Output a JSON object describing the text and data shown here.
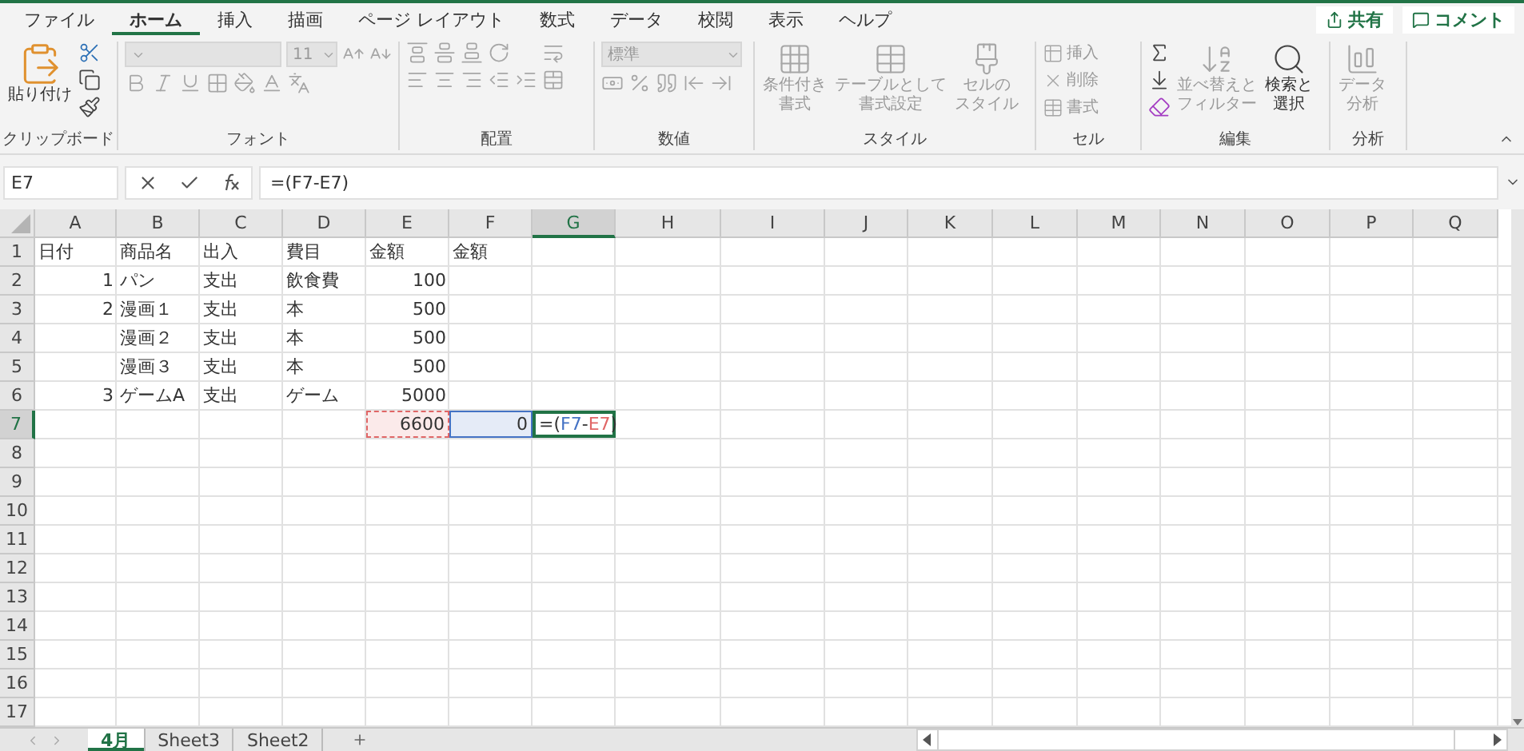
{
  "menu_tabs": [
    {
      "label": "ファイル",
      "selected": false
    },
    {
      "label": "ホーム",
      "selected": true
    },
    {
      "label": "挿入",
      "selected": false
    },
    {
      "label": "描画",
      "selected": false
    },
    {
      "label": "ページ レイアウト",
      "selected": false
    },
    {
      "label": "数式",
      "selected": false
    },
    {
      "label": "データ",
      "selected": false
    },
    {
      "label": "校閲",
      "selected": false
    },
    {
      "label": "表示",
      "selected": false
    },
    {
      "label": "ヘルプ",
      "selected": false
    }
  ],
  "share_button": "共有",
  "comment_button": "コメント",
  "ribbon_groups": [
    {
      "kind": "clipboard",
      "label": "クリップボード",
      "disabled": false,
      "buttons": [
        {
          "lines": [
            "貼り付け"
          ],
          "disabled": false
        }
      ]
    },
    {
      "kind": "font",
      "label": "フォント",
      "disabled": true,
      "size": "11"
    },
    {
      "kind": "alignment",
      "label": "配置",
      "disabled": true
    },
    {
      "kind": "number",
      "label": "数値",
      "disabled": true,
      "format": "標準"
    },
    {
      "kind": "styles",
      "label": "スタイル",
      "buttons": [
        {
          "lines": [
            "条件付き",
            "書式"
          ],
          "disabled": true
        },
        {
          "lines": [
            "テーブルとして",
            "書式設定"
          ],
          "disabled": true
        },
        {
          "lines": [
            "セルの",
            "スタイル"
          ],
          "disabled": true
        }
      ]
    },
    {
      "kind": "cells",
      "label": "セル",
      "buttons": [
        {
          "lines": [
            "挿入"
          ],
          "disabled": true
        },
        {
          "lines": [
            "削除"
          ],
          "disabled": true
        },
        {
          "lines": [
            "書式"
          ],
          "disabled": true
        }
      ]
    },
    {
      "kind": "editing",
      "label": "編集",
      "disabled": false,
      "buttons": [
        {
          "lines": [
            "並べ替えと",
            "フィルター"
          ],
          "disabled": true
        },
        {
          "lines": [
            "検索と",
            "選択"
          ],
          "disabled": false
        }
      ]
    },
    {
      "kind": "analysis",
      "label": "分析",
      "buttons": [
        {
          "lines": [
            "データ",
            "分析"
          ],
          "disabled": true
        }
      ]
    }
  ],
  "formula_bar": {
    "name_box": "E7",
    "formula": "=(F7-E7)"
  },
  "columns": [
    {
      "label": "A",
      "selected": false
    },
    {
      "label": "B",
      "selected": false
    },
    {
      "label": "C",
      "selected": false
    },
    {
      "label": "D",
      "selected": false
    },
    {
      "label": "E",
      "selected": false
    },
    {
      "label": "F",
      "selected": false
    },
    {
      "label": "G",
      "selected": true
    },
    {
      "label": "H",
      "selected": false
    },
    {
      "label": "I",
      "selected": false
    },
    {
      "label": "J",
      "selected": false
    },
    {
      "label": "K",
      "selected": false
    },
    {
      "label": "L",
      "selected": false
    },
    {
      "label": "M",
      "selected": false
    },
    {
      "label": "N",
      "selected": false
    },
    {
      "label": "O",
      "selected": false
    },
    {
      "label": "P",
      "selected": false
    },
    {
      "label": "Q",
      "selected": false
    }
  ],
  "rows": [
    {
      "label": "1",
      "selected": false,
      "cells": [
        {
          "text": "日付",
          "kind": "text"
        },
        {
          "text": "商品名",
          "kind": "text"
        },
        {
          "text": "出入",
          "kind": "text"
        },
        {
          "text": "費目",
          "kind": "text"
        },
        {
          "text": "金額",
          "kind": "text"
        },
        {
          "text": "金額",
          "kind": "text"
        }
      ]
    },
    {
      "label": "2",
      "selected": false,
      "cells": [
        {
          "text": "1",
          "kind": "number"
        },
        {
          "text": "パン",
          "kind": "text"
        },
        {
          "text": "支出",
          "kind": "text"
        },
        {
          "text": "飲食費",
          "kind": "text"
        },
        {
          "text": "100",
          "kind": "number"
        }
      ]
    },
    {
      "label": "3",
      "selected": false,
      "cells": [
        {
          "text": "2",
          "kind": "number"
        },
        {
          "text": "漫画１",
          "kind": "text"
        },
        {
          "text": "支出",
          "kind": "text"
        },
        {
          "text": "本",
          "kind": "text"
        },
        {
          "text": "500",
          "kind": "number"
        }
      ]
    },
    {
      "label": "4",
      "selected": false,
      "cells": [
        null,
        {
          "text": "漫画２",
          "kind": "text"
        },
        {
          "text": "支出",
          "kind": "text"
        },
        {
          "text": "本",
          "kind": "text"
        },
        {
          "text": "500",
          "kind": "number"
        }
      ]
    },
    {
      "label": "5",
      "selected": false,
      "cells": [
        null,
        {
          "text": "漫画３",
          "kind": "text"
        },
        {
          "text": "支出",
          "kind": "text"
        },
        {
          "text": "本",
          "kind": "text"
        },
        {
          "text": "500",
          "kind": "number"
        }
      ]
    },
    {
      "label": "6",
      "selected": false,
      "cells": [
        {
          "text": "3",
          "kind": "number"
        },
        {
          "text": "ゲームA",
          "kind": "text"
        },
        {
          "text": "支出",
          "kind": "text"
        },
        {
          "text": "ゲーム",
          "kind": "text"
        },
        {
          "text": "5000",
          "kind": "number"
        }
      ]
    },
    {
      "label": "7",
      "selected": true,
      "cells": [
        null,
        null,
        null,
        null,
        {
          "text": "6600",
          "kind": "number",
          "color": "#e06666",
          "marquee": true
        },
        {
          "text": "0",
          "kind": "number",
          "color": "#4472c4",
          "marquee": false
        },
        {
          "kind": "edit",
          "segments": [
            {
              "text": "=("
            },
            {
              "text": "F7",
              "color": "#4472c4"
            },
            {
              "text": "-"
            },
            {
              "text": "E7",
              "color": "#e06666"
            },
            {
              "text": ")"
            }
          ]
        }
      ]
    },
    {
      "label": "8",
      "selected": false,
      "cells": []
    },
    {
      "label": "9",
      "selected": false,
      "cells": []
    },
    {
      "label": "10",
      "selected": false,
      "cells": []
    },
    {
      "label": "11",
      "selected": false,
      "cells": []
    },
    {
      "label": "12",
      "selected": false,
      "cells": []
    },
    {
      "label": "13",
      "selected": false,
      "cells": []
    },
    {
      "label": "14",
      "selected": false,
      "cells": []
    },
    {
      "label": "15",
      "selected": false,
      "cells": []
    },
    {
      "label": "16",
      "selected": false,
      "cells": []
    },
    {
      "label": "17",
      "selected": false,
      "cells": []
    }
  ],
  "sheet_tabs": [
    {
      "label": "4月",
      "selected": true
    },
    {
      "label": "Sheet3",
      "selected": false
    },
    {
      "label": "Sheet2",
      "selected": false
    }
  ]
}
